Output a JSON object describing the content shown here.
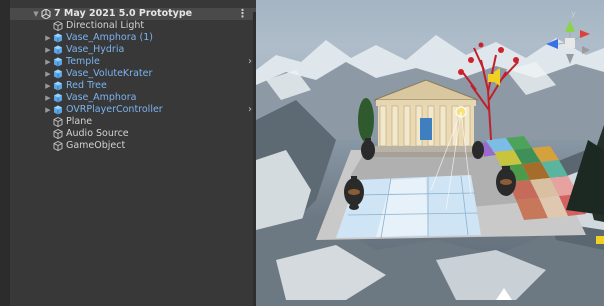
{
  "hierarchy": {
    "scene_title": "7 May 2021 5.0 Prototype",
    "items": [
      {
        "label": "Directional Light",
        "prefab": false,
        "expandable": false,
        "has_chevron": false,
        "icon": "gameobject-icon"
      },
      {
        "label": "Vase_Amphora (1)",
        "prefab": true,
        "expandable": true,
        "has_chevron": false,
        "icon": "prefab-icon"
      },
      {
        "label": "Vase_Hydria",
        "prefab": true,
        "expandable": true,
        "has_chevron": false,
        "icon": "prefab-icon"
      },
      {
        "label": "Temple",
        "prefab": true,
        "expandable": true,
        "has_chevron": true,
        "icon": "prefab-icon"
      },
      {
        "label": "Vase_VoluteKrater",
        "prefab": true,
        "expandable": true,
        "has_chevron": false,
        "icon": "prefab-icon"
      },
      {
        "label": "Red Tree",
        "prefab": true,
        "expandable": true,
        "has_chevron": false,
        "icon": "prefab-icon"
      },
      {
        "label": "Vase_Amphora",
        "prefab": true,
        "expandable": true,
        "has_chevron": false,
        "icon": "prefab-icon"
      },
      {
        "label": "OVRPlayerController",
        "prefab": true,
        "expandable": true,
        "has_chevron": true,
        "icon": "prefab-icon"
      },
      {
        "label": "Plane",
        "prefab": false,
        "expandable": false,
        "has_chevron": false,
        "icon": "gameobject-icon"
      },
      {
        "label": "Audio Source",
        "prefab": false,
        "expandable": false,
        "has_chevron": false,
        "icon": "gameobject-icon"
      },
      {
        "label": "GameObject",
        "prefab": false,
        "expandable": false,
        "has_chevron": false,
        "icon": "gameobject-icon"
      }
    ]
  },
  "gizmo": {
    "axis_y_label": "y",
    "colors": {
      "x": "#e0403a",
      "y": "#8ad34a",
      "z": "#3a72e6"
    }
  },
  "colors": {
    "prefab_text": "#7bb3f0",
    "normal_text": "#d2d2d2",
    "panel_bg": "#383838"
  }
}
